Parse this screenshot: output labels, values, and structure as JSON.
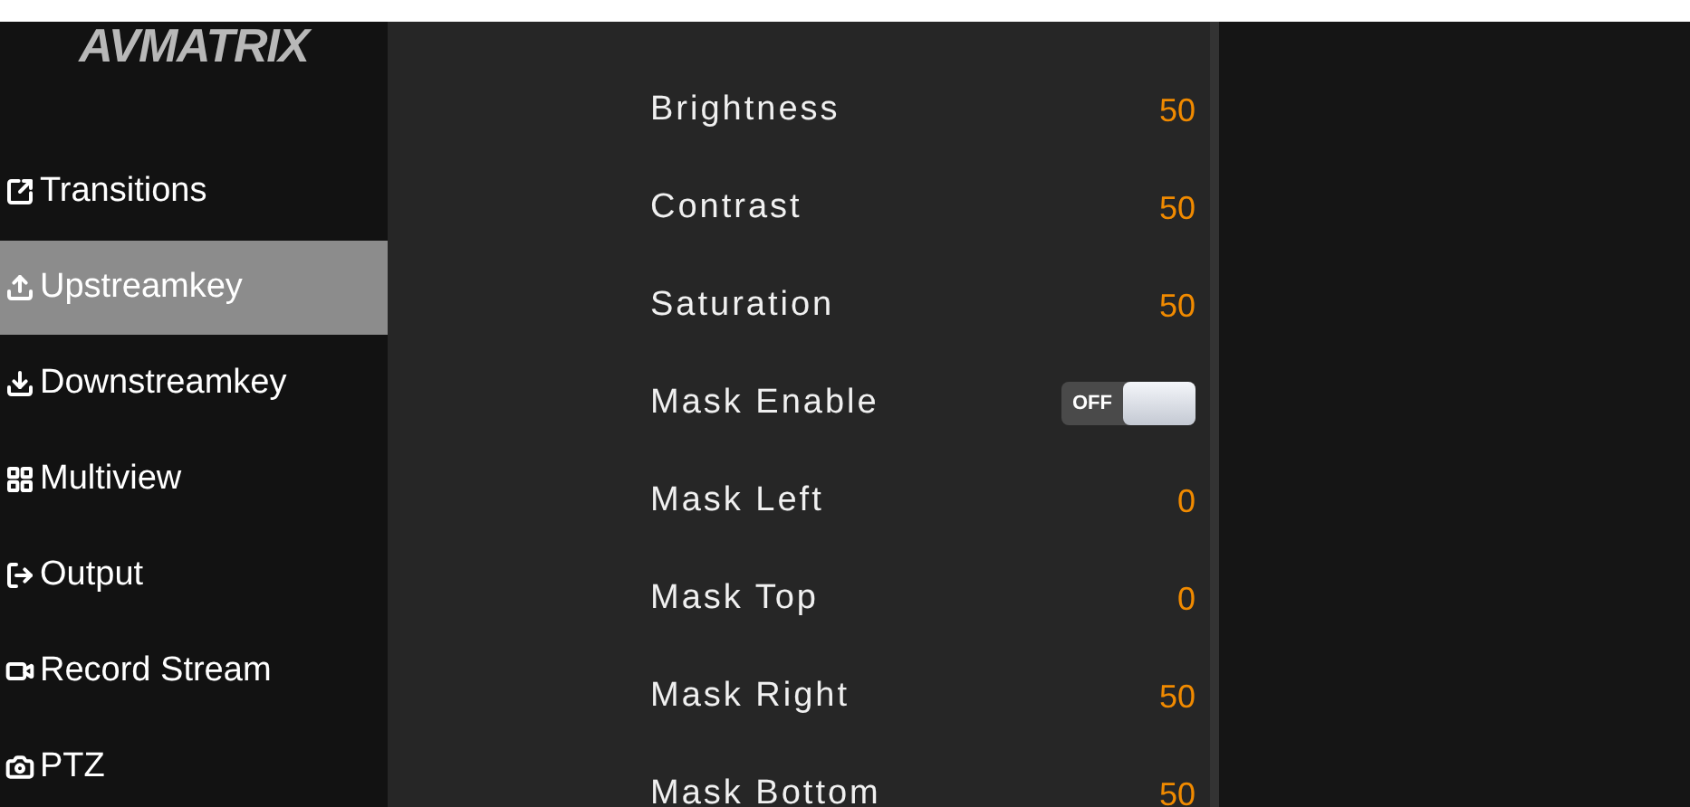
{
  "logo": {
    "text": "AVMATRIX"
  },
  "sidebar": {
    "items": [
      {
        "label": "Transitions",
        "selected": false
      },
      {
        "label": "Upstreamkey",
        "selected": true
      },
      {
        "label": "Downstreamkey",
        "selected": false
      },
      {
        "label": "Multiview",
        "selected": false
      },
      {
        "label": "Output",
        "selected": false
      },
      {
        "label": "Record Stream",
        "selected": false
      },
      {
        "label": "PTZ",
        "selected": false
      }
    ]
  },
  "settings": [
    {
      "kind": "value",
      "label": "Brightness",
      "value": "50"
    },
    {
      "kind": "value",
      "label": "Contrast",
      "value": "50"
    },
    {
      "kind": "value",
      "label": "Saturation",
      "value": "50"
    },
    {
      "kind": "toggle",
      "label": "Mask Enable",
      "on": false,
      "state_label": "OFF"
    },
    {
      "kind": "value",
      "label": "Mask Left",
      "value": "0"
    },
    {
      "kind": "value",
      "label": "Mask Top",
      "value": "0"
    },
    {
      "kind": "value",
      "label": "Mask Right",
      "value": "50"
    },
    {
      "kind": "value",
      "label": "Mask Bottom",
      "value": "50"
    }
  ]
}
